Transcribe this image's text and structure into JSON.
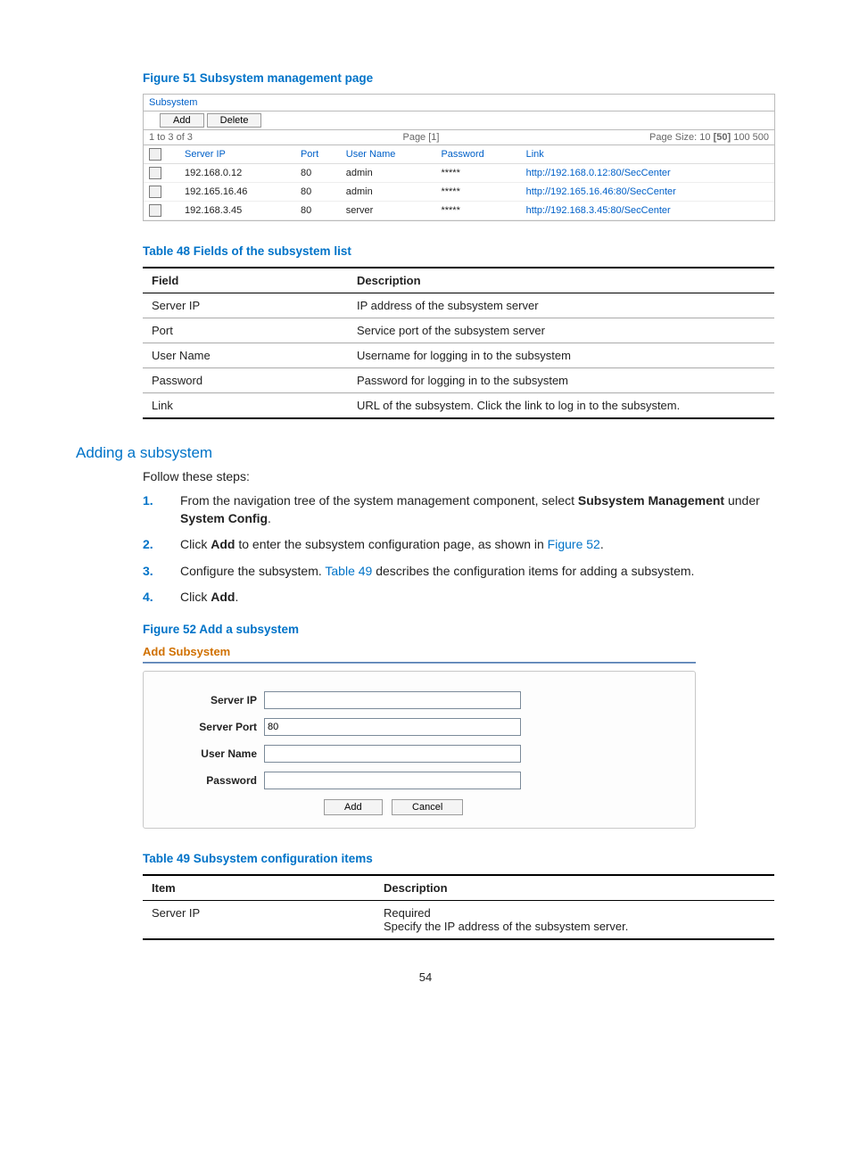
{
  "fig51": {
    "title": "Figure 51 Subsystem management page",
    "panel_title": "Subsystem",
    "add_btn": "Add",
    "del_btn": "Delete",
    "range": "1 to 3 of 3",
    "page_label": "Page [1]",
    "size_label_prefix": "Page Size: ",
    "size_10": "10",
    "size_50": "[50]",
    "size_100": "100",
    "size_500": "500",
    "cols": {
      "ip": "Server IP",
      "port": "Port",
      "user": "User Name",
      "pwd": "Password",
      "link": "Link"
    },
    "rows": [
      {
        "ip": "192.168.0.12",
        "port": "80",
        "user": "admin",
        "pwd": "*****",
        "link": "http://192.168.0.12:80/SecCenter"
      },
      {
        "ip": "192.165.16.46",
        "port": "80",
        "user": "admin",
        "pwd": "*****",
        "link": "http://192.165.16.46:80/SecCenter"
      },
      {
        "ip": "192.168.3.45",
        "port": "80",
        "user": "server",
        "pwd": "*****",
        "link": "http://192.168.3.45:80/SecCenter"
      }
    ]
  },
  "tbl48": {
    "title": "Table 48 Fields of the subsystem list",
    "h1": "Field",
    "h2": "Description",
    "rows": [
      {
        "f": "Server IP",
        "d": "IP address of the subsystem server"
      },
      {
        "f": "Port",
        "d": "Service port of the subsystem server"
      },
      {
        "f": "User Name",
        "d": "Username for logging in to the subsystem"
      },
      {
        "f": "Password",
        "d": "Password for logging in to the subsystem"
      },
      {
        "f": "Link",
        "d": "URL of the subsystem. Click the link to log in to the subsystem."
      }
    ]
  },
  "sec": {
    "title": "Adding a subsystem",
    "lead": "Follow these steps:",
    "step1_a": "From the navigation tree of the system management component, select ",
    "step1_b": "Subsystem Management",
    "step1_c": " under ",
    "step1_d": "System Config",
    "step1_e": ".",
    "step2_a": "Click ",
    "step2_b": "Add",
    "step2_c": " to enter the subsystem configuration page, as shown in ",
    "step2_d": "Figure 52",
    "step2_e": ".",
    "step3_a": "Configure the subsystem. ",
    "step3_b": "Table 49",
    "step3_c": " describes the configuration items for adding a subsystem.",
    "step4_a": "Click ",
    "step4_b": "Add",
    "step4_c": "."
  },
  "fig52": {
    "title": "Figure 52 Add a subsystem",
    "panel_title": "Add Subsystem",
    "lbl_ip": "Server IP",
    "lbl_port": "Server Port",
    "lbl_user": "User Name",
    "lbl_pwd": "Password",
    "val_port": "80",
    "add_btn": "Add",
    "cancel_btn": "Cancel"
  },
  "tbl49": {
    "title": "Table 49 Subsystem configuration items",
    "h1": "Item",
    "h2": "Description",
    "rows": [
      {
        "f": "Server IP",
        "d1": "Required",
        "d2": "Specify the IP address of the subsystem server."
      }
    ]
  },
  "page_number": "54"
}
